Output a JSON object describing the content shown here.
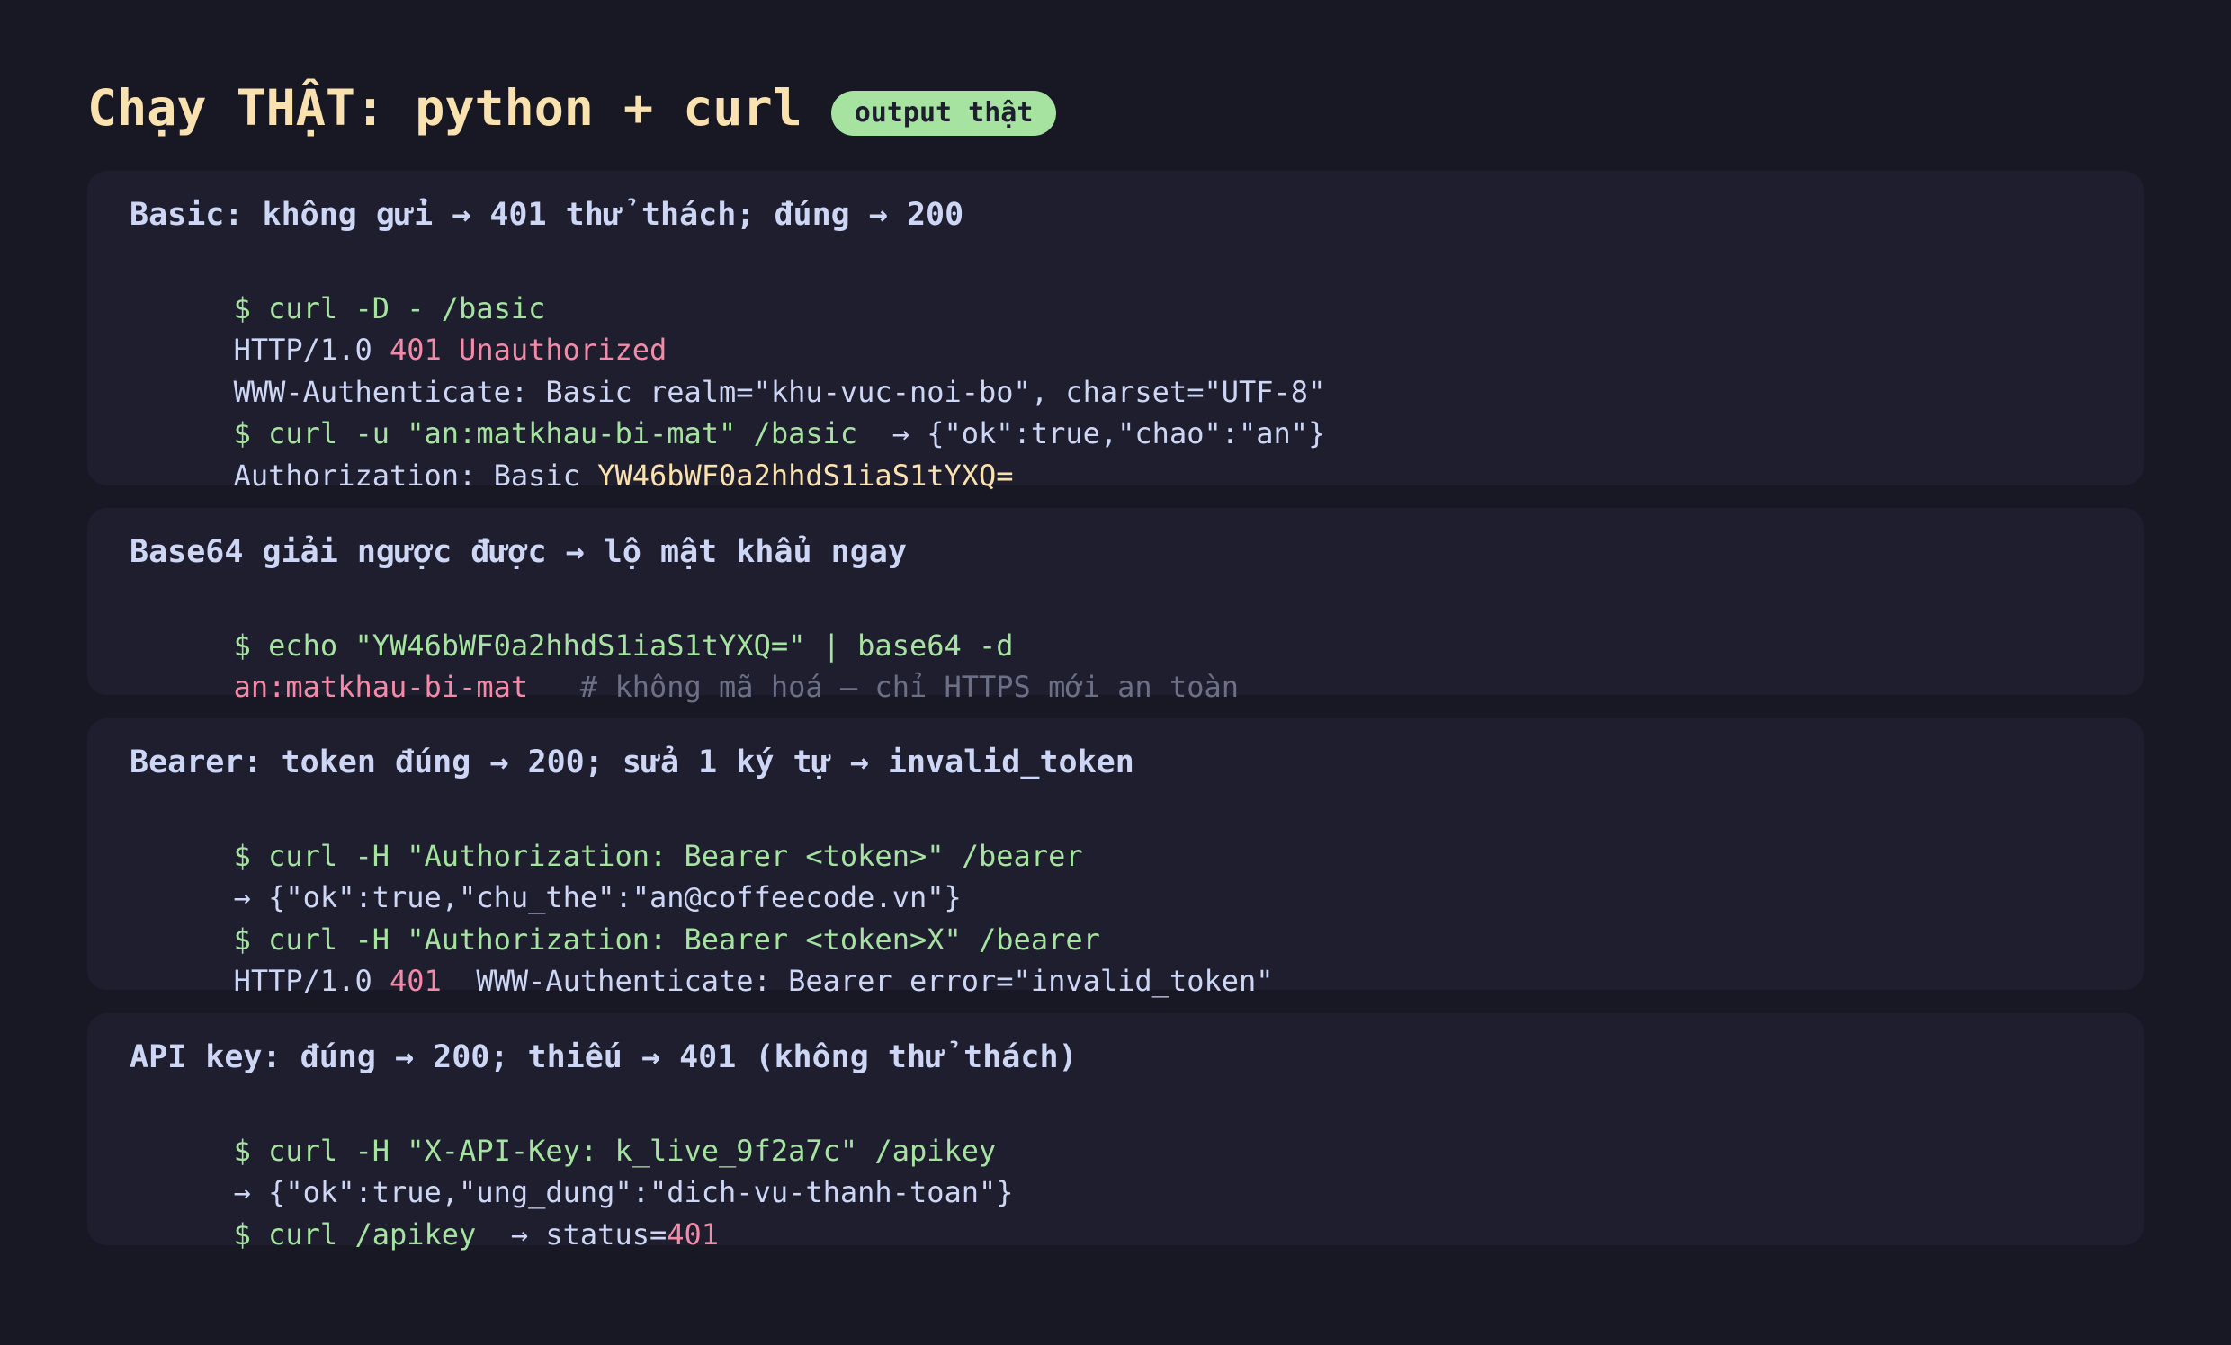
{
  "header": {
    "title": "Chạy THẬT: python + curl",
    "badge": "output thật"
  },
  "cards": [
    {
      "title": "Basic: không gửi → 401 thử thách; đúng → 200",
      "lines": [
        [
          {
            "t": "$ curl -D - /basic",
            "k": "cmd"
          }
        ],
        [
          {
            "t": "HTTP/1.0 ",
            "k": "txt"
          },
          {
            "t": "401 Unauthorized",
            "k": "err"
          }
        ],
        [
          {
            "t": "WWW-Authenticate: Basic realm=\"khu-vuc-noi-bo\", charset=\"UTF-8\"",
            "k": "txt"
          }
        ],
        [
          {
            "t": "$ curl -u \"an:matkhau-bi-mat\" /basic",
            "k": "cmd"
          },
          {
            "t": "  → {\"ok\":true,\"chao\":\"an\"}",
            "k": "txt"
          }
        ],
        [
          {
            "t": "Authorization: Basic ",
            "k": "txt"
          },
          {
            "t": "YW46bWF0a2hhdS1iaS1tYXQ=",
            "k": "hl"
          }
        ]
      ]
    },
    {
      "title": "Base64 giải ngược được → lộ mật khẩu ngay",
      "lines": [
        [
          {
            "t": "$ echo \"YW46bWF0a2hhdS1iaS1tYXQ=\" | base64 -d",
            "k": "cmd"
          }
        ],
        [
          {
            "t": "an:matkhau-bi-mat",
            "k": "err"
          },
          {
            "t": "   # không mã hoá — chỉ HTTPS mới an toàn",
            "k": "cmt"
          }
        ]
      ]
    },
    {
      "title": "Bearer: token đúng → 200; sửa 1 ký tự → invalid_token",
      "lines": [
        [
          {
            "t": "$ curl -H \"Authorization: Bearer <token>\" /bearer",
            "k": "cmd"
          }
        ],
        [
          {
            "t": "→ {\"ok\":true,\"chu_the\":\"an@coffeecode.vn\"}",
            "k": "txt"
          }
        ],
        [
          {
            "t": "$ curl -H \"Authorization: Bearer <token>X\" /bearer",
            "k": "cmd"
          }
        ],
        [
          {
            "t": "HTTP/1.0 ",
            "k": "txt"
          },
          {
            "t": "401",
            "k": "err"
          },
          {
            "t": "  WWW-Authenticate: Bearer error=\"invalid_token\"",
            "k": "txt"
          }
        ]
      ]
    },
    {
      "title": "API key: đúng → 200; thiếu → 401 (không thử thách)",
      "lines": [
        [
          {
            "t": "$ curl -H \"X-API-Key: k_live_9f2a7c\" /apikey",
            "k": "cmd"
          }
        ],
        [
          {
            "t": "→ {\"ok\":true,\"ung_dung\":\"dich-vu-thanh-toan\"}",
            "k": "txt"
          }
        ],
        [
          {
            "t": "$ curl /apikey",
            "k": "cmd"
          },
          {
            "t": "  → status=",
            "k": "txt"
          },
          {
            "t": "401",
            "k": "err"
          }
        ]
      ]
    }
  ]
}
